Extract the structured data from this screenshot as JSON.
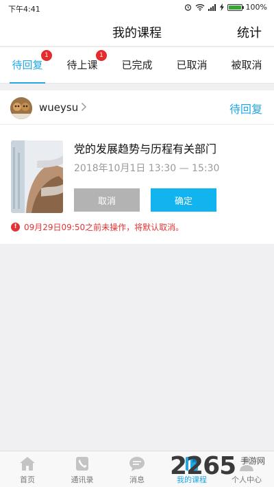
{
  "status_bar": {
    "time": "下午4:41",
    "battery": "100%"
  },
  "nav": {
    "title": "我的课程",
    "stats": "统计"
  },
  "tabs": [
    {
      "label": "待回复",
      "badge": "1",
      "active": true
    },
    {
      "label": "待上课",
      "badge": "1",
      "active": false
    },
    {
      "label": "已完成",
      "badge": "",
      "active": false
    },
    {
      "label": "已取消",
      "badge": "",
      "active": false
    },
    {
      "label": "被取消",
      "badge": "",
      "active": false
    }
  ],
  "card": {
    "username": "wueysu",
    "status": "待回复",
    "course_title": "党的发展趋势与历程有关部门",
    "course_time": "2018年10月1日 13:30 — 15:30",
    "cancel_label": "取消",
    "confirm_label": "确定",
    "warning": "09月29日09:50之前未操作，将默认取消。"
  },
  "bottom_nav": [
    {
      "label": "首页",
      "icon": "home-icon"
    },
    {
      "label": "通讯录",
      "icon": "contacts-icon"
    },
    {
      "label": "消息",
      "icon": "message-icon"
    },
    {
      "label": "我的课程",
      "icon": "course-icon",
      "active": true
    },
    {
      "label": "个人中心",
      "icon": "profile-icon"
    }
  ],
  "watermark": {
    "number": "2265",
    "text": "手游网"
  },
  "colors": {
    "accent": "#1fa7e6",
    "badge": "#e52b2b",
    "confirm": "#12b4ef",
    "warning": "#e23434"
  }
}
